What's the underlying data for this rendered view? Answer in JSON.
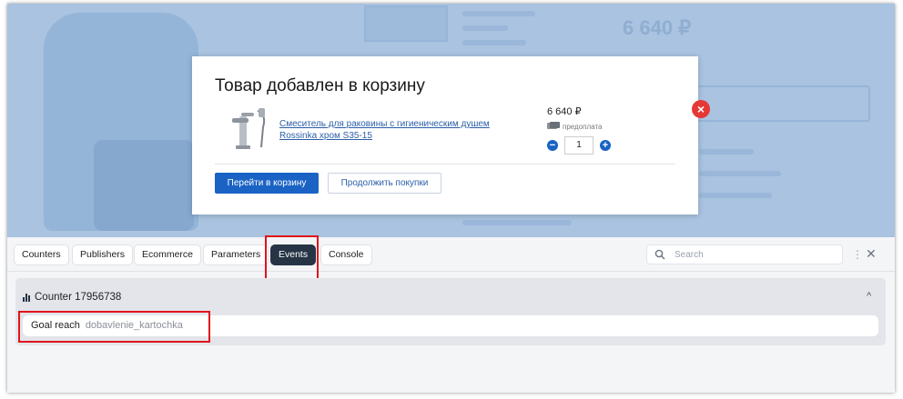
{
  "modal": {
    "title": "Товар добавлен в корзину",
    "close_glyph": "×",
    "product_name": "Смеситель для раковины с гигиеническим душем Rossinka хром S35-15",
    "price": "6 640 ₽",
    "prepay_label": "предоплата",
    "quantity": "1",
    "minus_glyph": "−",
    "plus_glyph": "+",
    "go_to_cart": "Перейти в корзину",
    "continue_shopping": "Продолжить покупки"
  },
  "background": {
    "price": "6 640 ₽"
  },
  "devtools": {
    "tabs": [
      {
        "label": "Counters"
      },
      {
        "label": "Publishers"
      },
      {
        "label": "Ecommerce"
      },
      {
        "label": "Parameters"
      },
      {
        "label": "Events",
        "active": true
      },
      {
        "label": "Console"
      }
    ],
    "search_placeholder": "Search",
    "more_glyph": "⋮",
    "close_glyph": "✕",
    "counter": {
      "title": "Counter 17956738",
      "chevron": "^"
    },
    "event": {
      "label": "Goal reach",
      "value": "dobavlenie_kartochka"
    }
  },
  "colors": {
    "accent_blue": "#1a63c4",
    "active_tab": "#263445",
    "highlight_red": "#e0141b",
    "overlay": "#a9c3e0"
  }
}
